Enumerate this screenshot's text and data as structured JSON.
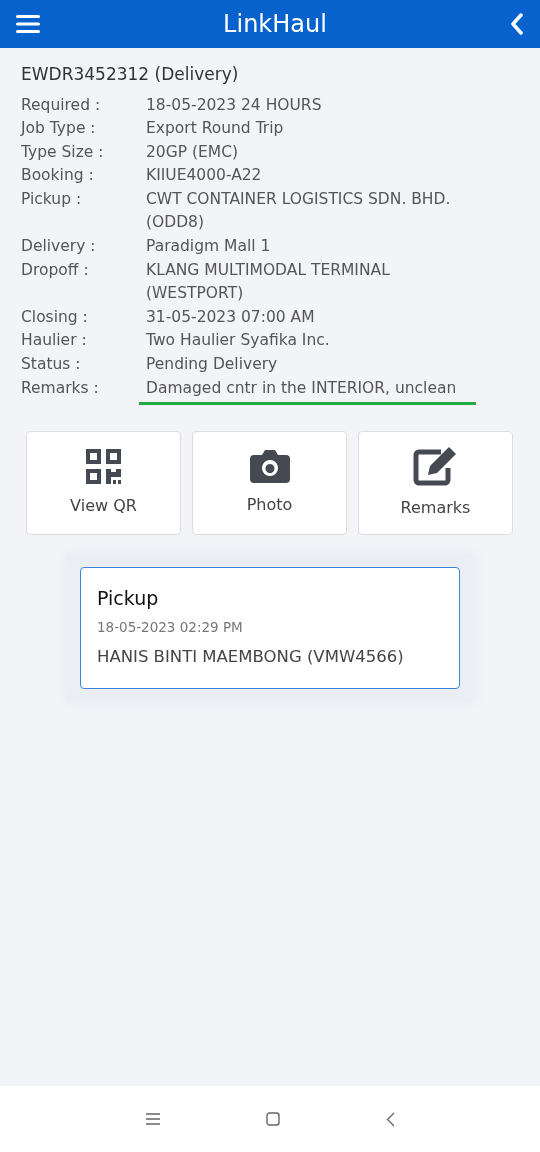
{
  "header": {
    "title": "LinkHaul"
  },
  "job": {
    "title": "EWDR3452312 (Delivery)",
    "fields": [
      {
        "label": "Required :",
        "value": "18-05-2023 24 HOURS",
        "highlighted": false
      },
      {
        "label": "Job Type :",
        "value": "Export Round Trip",
        "highlighted": false
      },
      {
        "label": "Type Size :",
        "value": "20GP (EMC)",
        "highlighted": false
      },
      {
        "label": "Booking :",
        "value": "KIIUE4000-A22",
        "highlighted": false
      },
      {
        "label": "Pickup :",
        "value": "CWT CONTAINER LOGISTICS SDN. BHD. (ODD8)",
        "highlighted": false
      },
      {
        "label": "Delivery :",
        "value": "Paradigm Mall 1",
        "highlighted": false
      },
      {
        "label": "Dropoff :",
        "value": "KLANG MULTIMODAL TERMINAL (WESTPORT)",
        "highlighted": false
      },
      {
        "label": "Closing :",
        "value": "31-05-2023 07:00 AM",
        "highlighted": false
      },
      {
        "label": "Haulier :",
        "value": "Two Haulier Syafika Inc.",
        "highlighted": false
      },
      {
        "label": "Status :",
        "value": "Pending Delivery",
        "highlighted": false
      },
      {
        "label": "Remarks :",
        "value": "Damaged cntr in the INTERIOR, unclean",
        "highlighted": true
      }
    ]
  },
  "actions": [
    {
      "kind": "qr",
      "label": "View QR"
    },
    {
      "kind": "camera",
      "label": "Photo"
    },
    {
      "kind": "edit",
      "label": "Remarks"
    }
  ],
  "events": [
    {
      "title": "Pickup",
      "time": "18-05-2023 02:29 PM",
      "detail": "HANIS BINTI MAEMBONG (VMW4566)"
    }
  ]
}
